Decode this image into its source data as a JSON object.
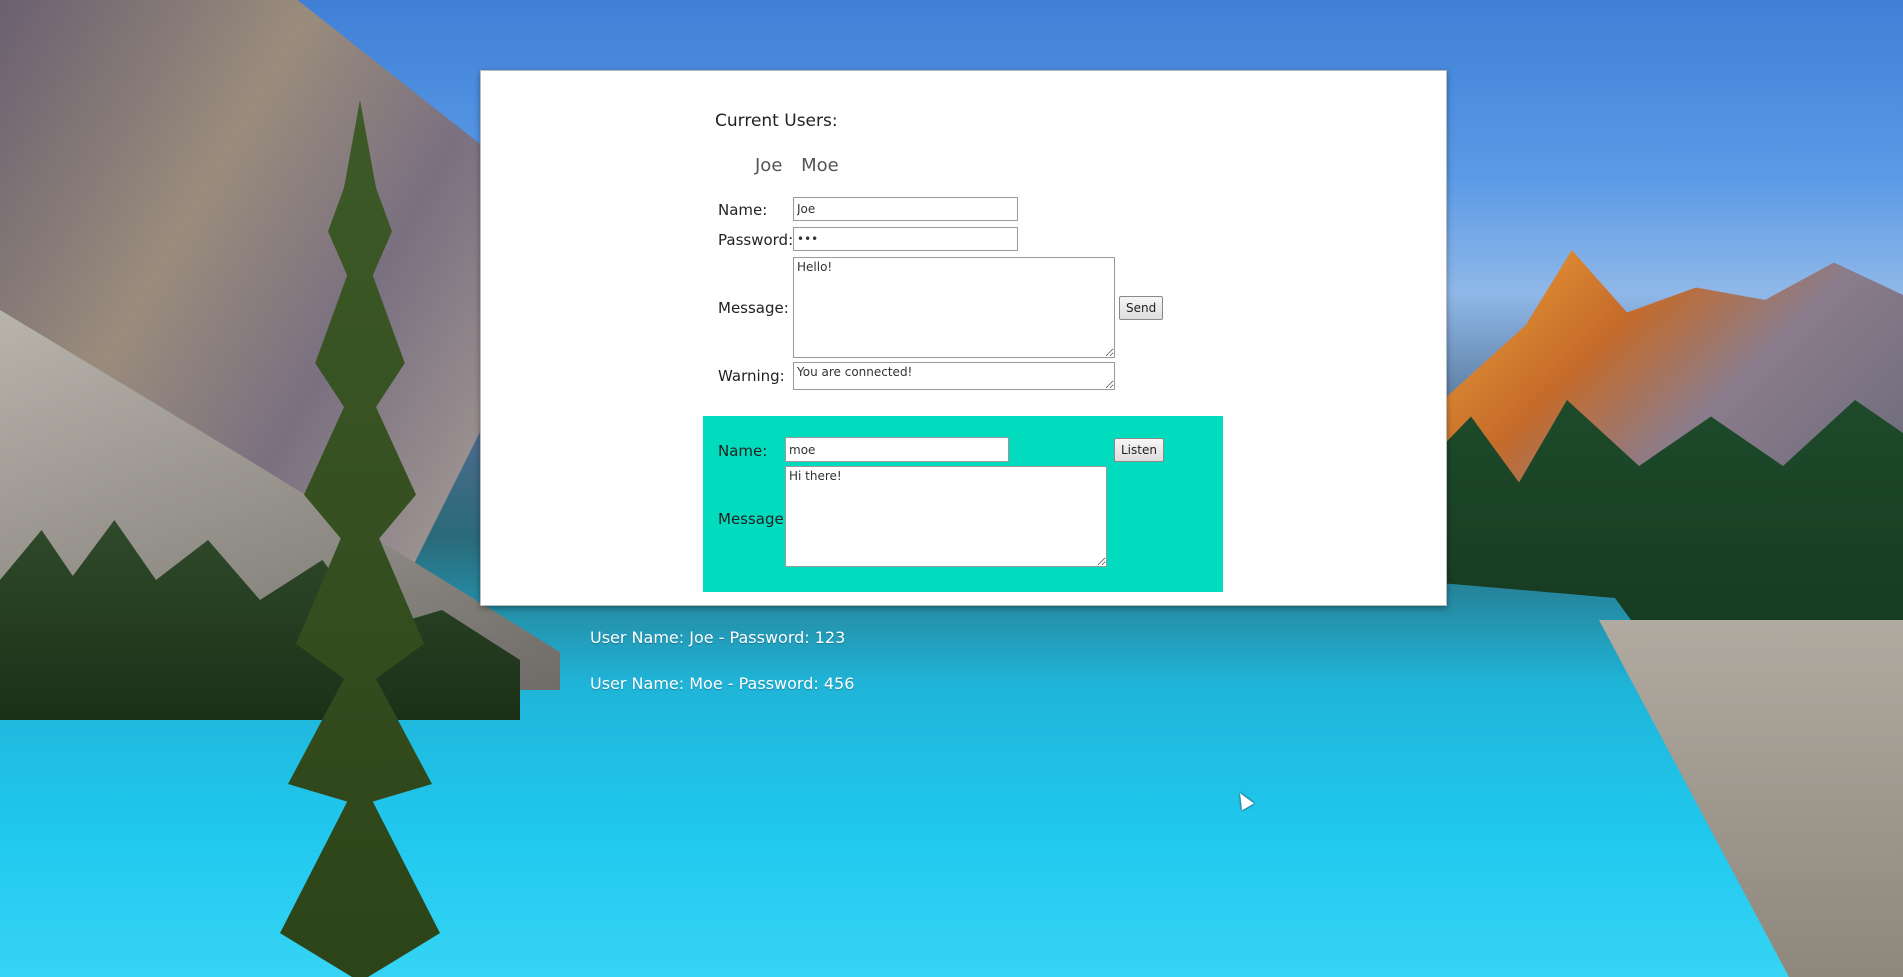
{
  "panel": {
    "title": "Current Users:",
    "users": [
      "Joe",
      "Moe"
    ]
  },
  "sender": {
    "name_label": "Name:",
    "name_value": "Joe",
    "password_label": "Password:",
    "password_value": "123",
    "message_label": "Message:",
    "message_value": "Hello!",
    "send_label": "Send",
    "warning_label": "Warning:",
    "warning_value": "You are connected!"
  },
  "listener": {
    "name_label": "Name:",
    "name_value": "moe",
    "listen_label": "Listen",
    "message_label": "Message:",
    "message_value": "Hi there!",
    "background_color": "#00dcbd"
  },
  "credentials": [
    "User Name: Joe - Password: 123",
    "User Name: Moe - Password: 456"
  ]
}
